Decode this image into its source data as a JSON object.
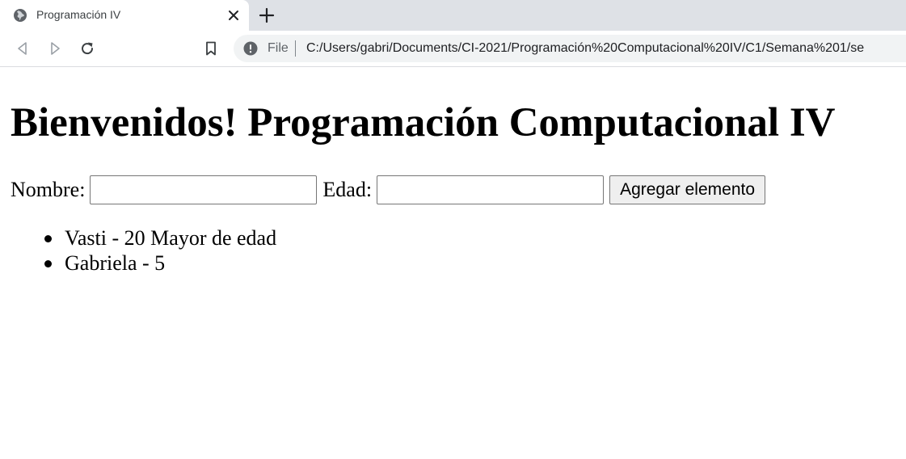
{
  "browser": {
    "tab": {
      "title": "Programación IV",
      "favicon_icon": "globe-icon",
      "close_icon": "close-icon"
    },
    "new_tab_icon": "plus-icon",
    "toolbar": {
      "back_icon": "back-arrow-icon",
      "forward_icon": "forward-arrow-icon",
      "reload_icon": "reload-icon",
      "bookmark_icon": "bookmark-icon"
    },
    "omnibox": {
      "info_icon": "info-icon",
      "scheme_label": "File",
      "url": "C:/Users/gabri/Documents/CI-2021/Programación%20Computacional%20IV/C1/Semana%201/se"
    }
  },
  "page": {
    "title": "Bienvenidos! Programación Computacional IV",
    "form": {
      "name_label": "Nombre:",
      "name_value": "",
      "age_label": "Edad:",
      "age_value": "",
      "submit_label": "Agregar elemento"
    },
    "items": [
      "Vasti - 20 Mayor de edad",
      "Gabriela - 5"
    ]
  },
  "colors": {
    "tabstrip_bg": "#dee1e6",
    "omnibox_bg": "#f1f3f4",
    "icon_gray": "#5f6368"
  }
}
